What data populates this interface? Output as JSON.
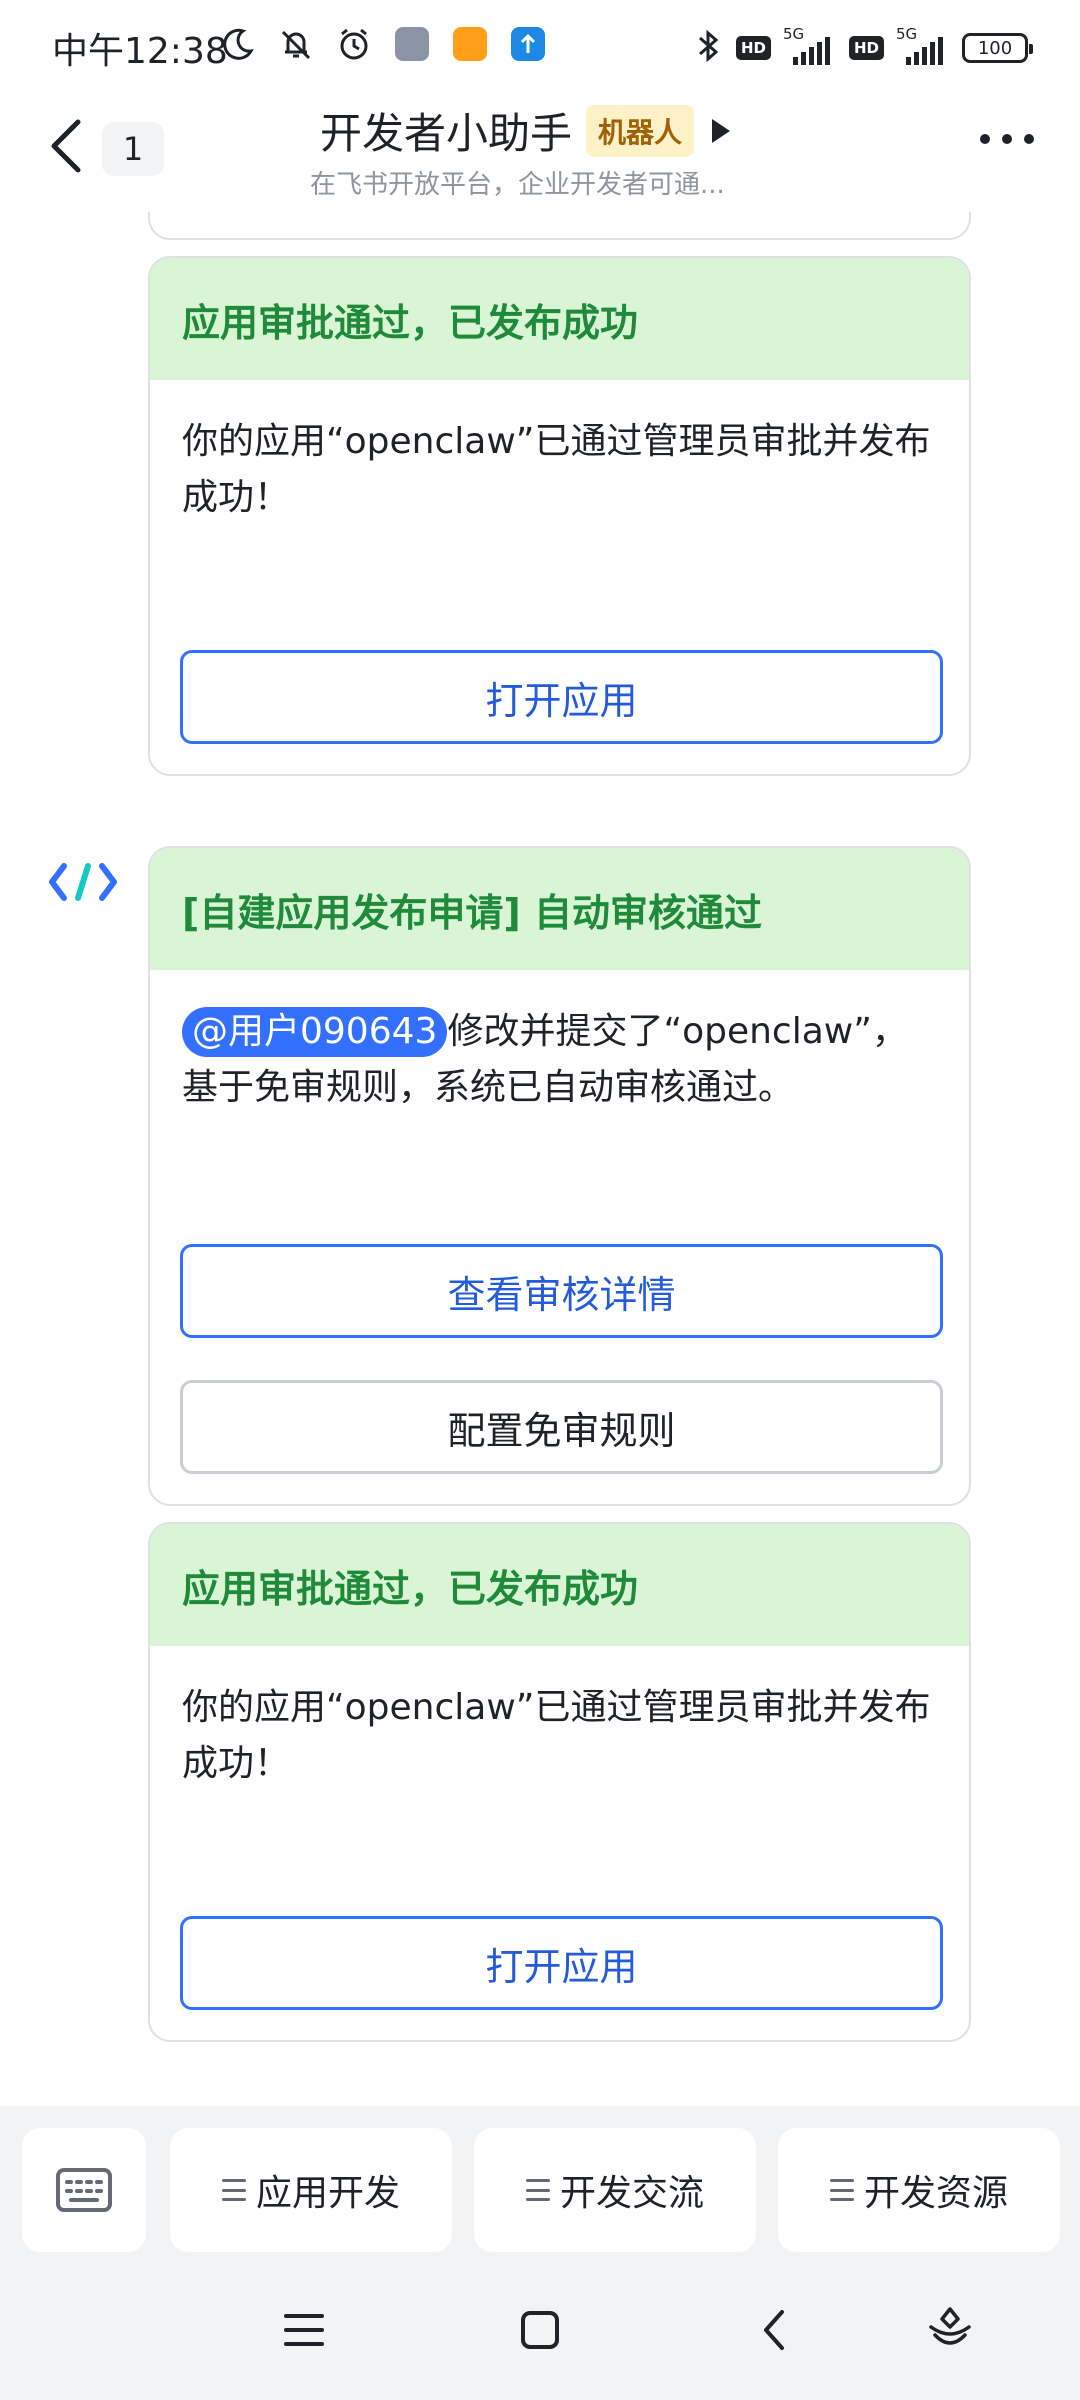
{
  "status_bar": {
    "time": "中午12:38",
    "network_1": "5G",
    "network_2": "5G",
    "hd_1": "HD",
    "hd_2": "HD",
    "battery": "100"
  },
  "header": {
    "unread_count": "1",
    "title": "开发者小助手",
    "bot_tag": "机器人",
    "subtitle": "在飞书开放平台，企业开发者可通..."
  },
  "messages": [
    {
      "title": "应用审批通过，已发布成功",
      "body": "你的应用“openclaw”已通过管理员审批并发布成功！",
      "button": "打开应用"
    },
    {
      "title": "[自建应用发布申请] 自动审核通过",
      "mention": "@用户090643",
      "body": "修改并提交了“openclaw”，基于免审规则，系统已自动审核通过。",
      "button_primary": "查看审核详情",
      "button_secondary": "配置免审规则"
    },
    {
      "title": "应用审批通过，已发布成功",
      "body": "你的应用“openclaw”已通过管理员审批并发布成功！",
      "button": "打开应用"
    }
  ],
  "menu": {
    "items": [
      "应用开发",
      "开发交流",
      "开发资源"
    ]
  },
  "colors": {
    "accent_blue": "#3370ff",
    "card_head_bg": "#d9f5d6",
    "card_head_text": "#1f8a3a",
    "bot_tag_bg": "#fdf1c7"
  }
}
